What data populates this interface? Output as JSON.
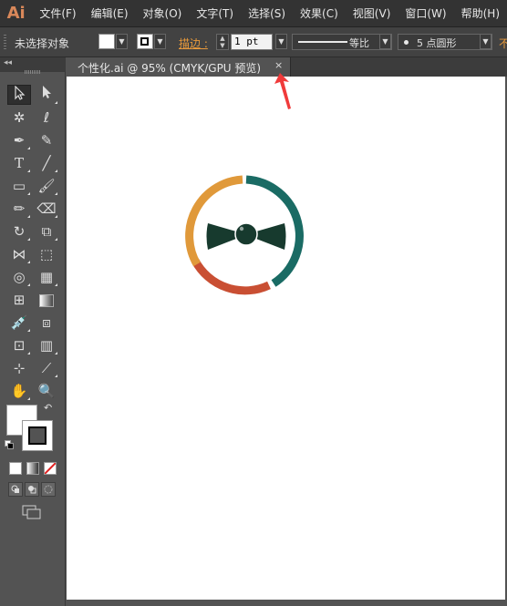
{
  "app": {
    "logo": "Ai"
  },
  "menubar": {
    "items": [
      "文件(F)",
      "编辑(E)",
      "对象(O)",
      "文字(T)",
      "选择(S)",
      "效果(C)",
      "视图(V)",
      "窗口(W)",
      "帮助(H)"
    ]
  },
  "controlbar": {
    "selection_label": "未选择对象",
    "stroke_label": "描边 :",
    "stroke_weight": "1 pt",
    "profile_label": "等比",
    "brush_label": "5 点圆形",
    "opacity_label": "不"
  },
  "document": {
    "tab_title": "个性化.ai @ 95% (CMYK/GPU 预览)",
    "close_glyph": "×"
  },
  "toolbox": {
    "collapse_glyph": "◂◂",
    "swap_glyph": "↶"
  },
  "colors": {
    "ring_teal": "#1a6b64",
    "ring_orange": "#e0993a",
    "ring_red": "#c94f33",
    "bowtie": "#173a2e",
    "annotation": "#f03a3a",
    "accent_label": "#e89a3c"
  }
}
